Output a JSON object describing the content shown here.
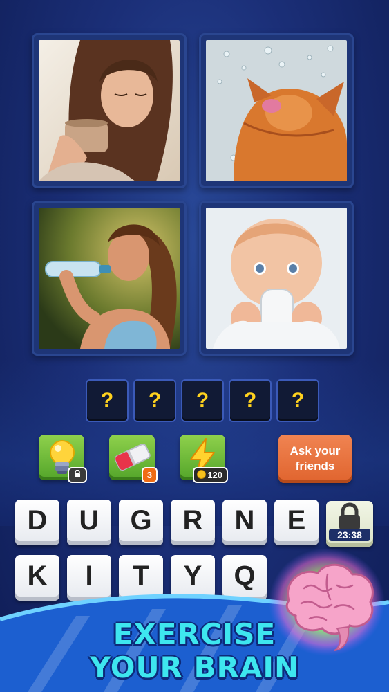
{
  "answer": {
    "slots": [
      "?",
      "?",
      "?",
      "?",
      "?"
    ]
  },
  "powerups": {
    "bulb": {
      "icon": "lightbulb-icon",
      "badge_icon": "lock-icon"
    },
    "eraser": {
      "icon": "eraser-icon",
      "count": "3"
    },
    "bolt": {
      "icon": "lightning-icon",
      "cost": "120"
    }
  },
  "ask_button": {
    "line1": "Ask your",
    "line2": "friends"
  },
  "keyboard": {
    "row1": [
      "D",
      "U",
      "G",
      "R",
      "N",
      "E"
    ],
    "row2": [
      "K",
      "I",
      "T",
      "Y",
      "Q"
    ],
    "timer": "23:38"
  },
  "tagline": {
    "line1": "EXERCISE",
    "line2": "YOUR BRAIN"
  },
  "colors": {
    "slot_text": "#ffd21e",
    "tagline": "#3ee6ef",
    "ask": "#e87040",
    "powerup": "#6cc039"
  }
}
